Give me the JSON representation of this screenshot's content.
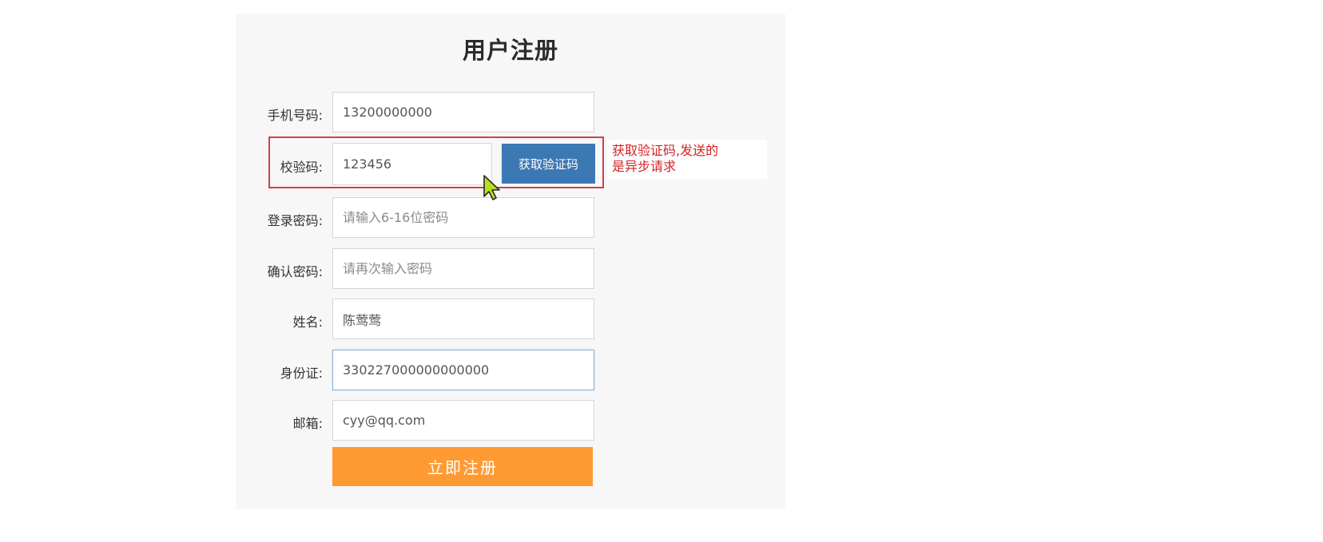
{
  "form": {
    "title": "用户注册",
    "fields": [
      {
        "label": "手机号码:",
        "value": "13200000000",
        "placeholder": ""
      },
      {
        "label": "校验码:",
        "value": "123456",
        "placeholder": ""
      },
      {
        "label": "登录密码:",
        "value": "",
        "placeholder": "请输入6-16位密码"
      },
      {
        "label": "确认密码:",
        "value": "",
        "placeholder": "请再次输入密码"
      },
      {
        "label": "姓名:",
        "value": "陈莺莺",
        "placeholder": ""
      },
      {
        "label": "身份证:",
        "value": "330227000000000000",
        "placeholder": ""
      },
      {
        "label": "邮箱:",
        "value": "cyy@qq.com",
        "placeholder": ""
      }
    ],
    "get_code_label": "获取验证码",
    "submit_label": "立即注册"
  },
  "annotation": {
    "line1": "获取验证码,发送的",
    "line2": "是异步请求",
    "color": "#d42222"
  },
  "colors": {
    "accent_blue": "#3c78b4",
    "submit_orange": "#ff9a32",
    "highlight_red": "#d0404a"
  },
  "icons": {
    "cursor": "mouse-pointer-icon"
  }
}
